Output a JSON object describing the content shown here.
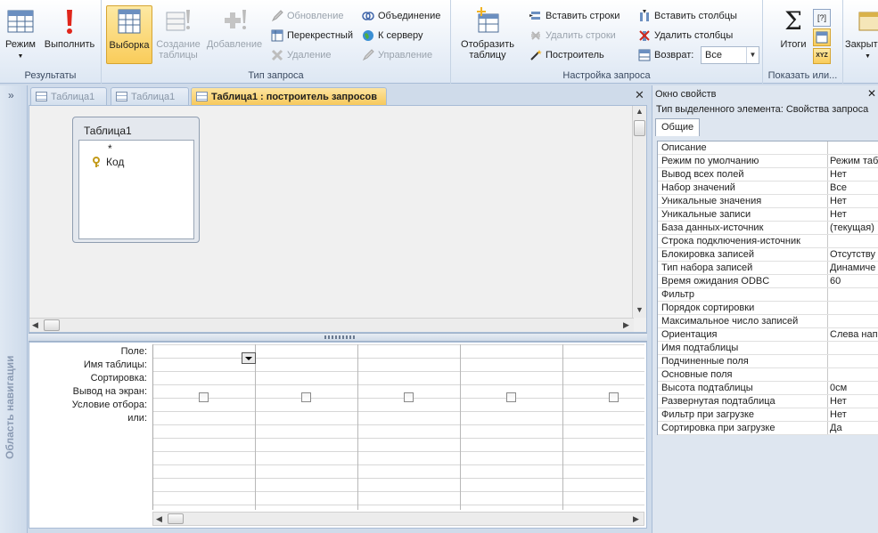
{
  "ribbon": {
    "results": {
      "title": "Результаты",
      "mode_label": "Режим",
      "run_label": "Выполнить"
    },
    "query_type": {
      "title": "Тип запроса",
      "select_label": "Выборка",
      "make_table_label_1": "Создание",
      "make_table_label_2": "таблицы",
      "append_label": "Добавление",
      "update_label": "Обновление",
      "crosstab_label": "Перекрестный",
      "delete_label": "Удаление",
      "union_label": "Объединение",
      "pass_through_label": "К серверу",
      "data_def_label": "Управление"
    },
    "query_setup": {
      "title": "Настройка запроса",
      "show_table_label_1": "Отобразить",
      "show_table_label_2": "таблицу",
      "insert_rows_label": "Вставить строки",
      "delete_rows_label": "Удалить строки",
      "builder_label": "Построитель",
      "insert_columns_label": "Вставить столбцы",
      "delete_columns_label": "Удалить столбцы",
      "return_label": "Возврат:",
      "return_value": "Все"
    },
    "show_hide": {
      "title": "Показать или...",
      "totals_label": "Итоги",
      "sigma_glyph": "Σ",
      "params_glyph": "[?]",
      "names_glyph": "XYZ"
    },
    "close": {
      "label": "Закрыть"
    }
  },
  "nav": {
    "toggle_glyph": "»",
    "label": "Область навигации"
  },
  "tabs": [
    {
      "label": "Таблица1",
      "active": false
    },
    {
      "label": "Таблица1",
      "active": false
    },
    {
      "label": "Таблица1 : построитель запросов",
      "active": true
    }
  ],
  "close_glyph": "✕",
  "design": {
    "table_title": "Таблица1",
    "fields": [
      "*",
      "Код"
    ]
  },
  "grid": {
    "row_labels": [
      "Поле:",
      "Имя таблицы:",
      "Сортировка:",
      "Вывод на экран:",
      "Условие отбора:",
      "или:"
    ]
  },
  "properties": {
    "title": "Окно свойств",
    "selection_type": "Тип выделенного элемента:  Свойства запроса",
    "tab_label": "Общие",
    "rows": [
      {
        "name": "Описание",
        "value": ""
      },
      {
        "name": "Режим по умолчанию",
        "value": "Режим табл"
      },
      {
        "name": "Вывод всех полей",
        "value": "Нет"
      },
      {
        "name": "Набор значений",
        "value": "Все"
      },
      {
        "name": "Уникальные значения",
        "value": "Нет"
      },
      {
        "name": "Уникальные записи",
        "value": "Нет"
      },
      {
        "name": "База данных-источник",
        "value": "(текущая)"
      },
      {
        "name": "Строка подключения-источник",
        "value": ""
      },
      {
        "name": "Блокировка записей",
        "value": "Отсутству"
      },
      {
        "name": "Тип набора записей",
        "value": "Динамиче"
      },
      {
        "name": "Время ожидания ODBC",
        "value": "60"
      },
      {
        "name": "Фильтр",
        "value": ""
      },
      {
        "name": "Порядок сортировки",
        "value": ""
      },
      {
        "name": "Максимальное число записей",
        "value": ""
      },
      {
        "name": "Ориентация",
        "value": "Слева нап"
      },
      {
        "name": "Имя подтаблицы",
        "value": ""
      },
      {
        "name": "Подчиненные поля",
        "value": ""
      },
      {
        "name": "Основные поля",
        "value": ""
      },
      {
        "name": "Высота подтаблицы",
        "value": "0см"
      },
      {
        "name": "Развернутая подтаблица",
        "value": "Нет"
      },
      {
        "name": "Фильтр при загрузке",
        "value": "Нет"
      },
      {
        "name": "Сортировка при загрузке",
        "value": "Да"
      }
    ]
  }
}
